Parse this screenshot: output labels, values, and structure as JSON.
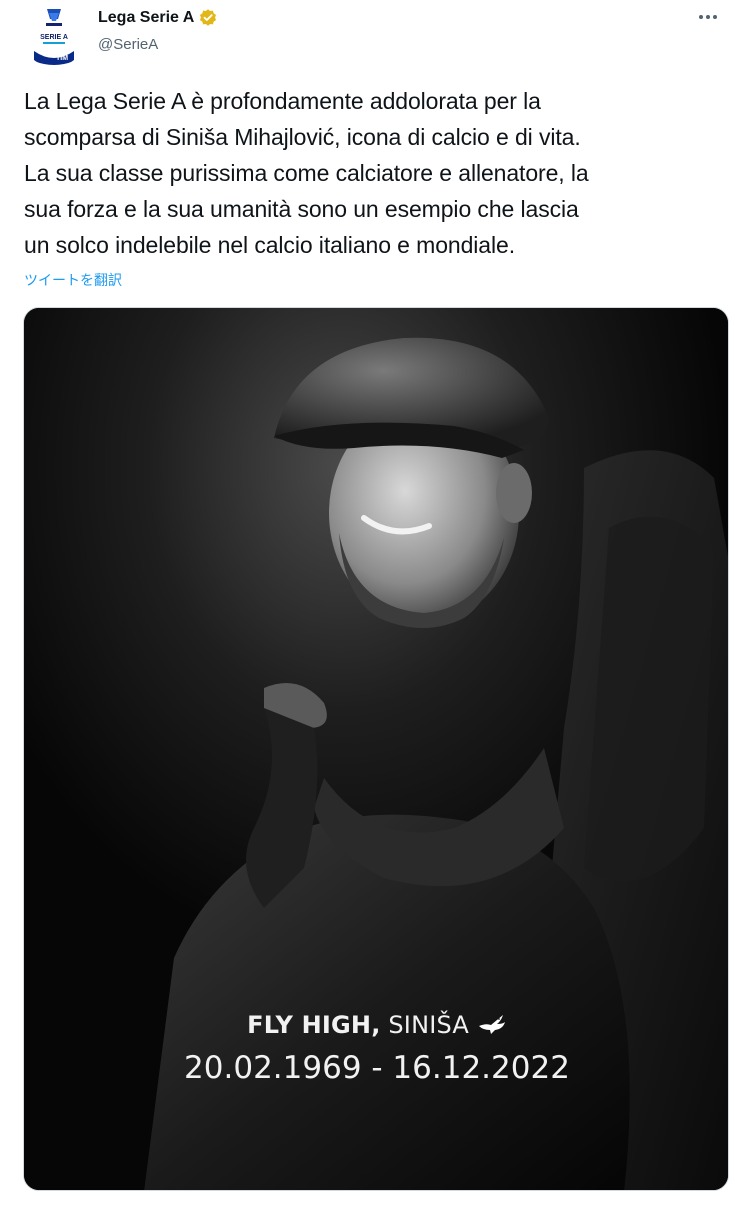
{
  "author": {
    "display_name": "Lega Serie A",
    "handle": "@SerieA",
    "verified": true,
    "avatar_text_top": "SERIE A",
    "avatar_text_bottom": "TIM",
    "avatar_icon": "serie-a-logo"
  },
  "tweet": {
    "text_lines": [
      "La Lega Serie A è profondamente addolorata per la",
      "scomparsa di Siniša Mihajlović, icona di calcio e di vita.",
      "La sua classe purissima come calciatore e allenatore, la",
      "sua forza e la sua umanità sono un esempio che lascia",
      "un solco indelebile nel calcio italiano e mondiale."
    ],
    "translate_label": "ツイートを翻訳"
  },
  "media": {
    "caption_bold": "FLY HIGH,",
    "caption_light": " SINIŠA",
    "caption_dates": "20.02.1969 - 16.12.2022",
    "dove_icon": "dove-icon"
  },
  "colors": {
    "link": "#1d9bf0",
    "secondary_text": "#536471",
    "verified_badge": "#e2b719"
  }
}
